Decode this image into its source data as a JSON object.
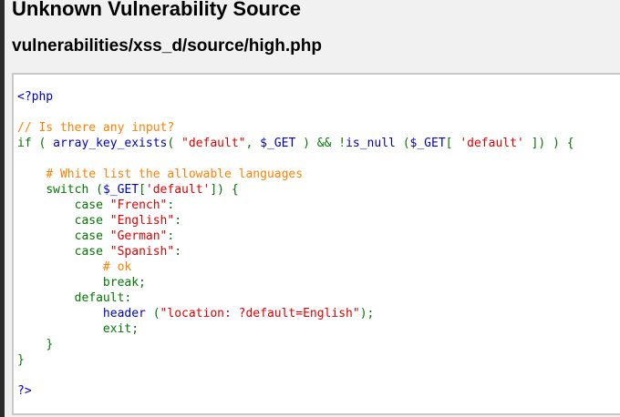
{
  "header": {
    "title": "Unknown Vulnerability Source",
    "file_path": "vulnerabilities/xss_d/source/high.php"
  },
  "colors": {
    "tag": "#0000bb",
    "comment": "#ff8000",
    "keyword": "#007700",
    "string": "#dd0000",
    "variable": "#0000bb"
  },
  "code": {
    "open_tag": "<?php",
    "comment_input": "// Is there any input?",
    "if_prefix": "if ( ",
    "fn_array_key_exists": "array_key_exists",
    "paren_open": "( ",
    "str_default_dq": "\"default\"",
    "comma": ", ",
    "var_get": "$_GET",
    "and_not": " ) && !",
    "fn_is_null": "is_null",
    "paren_space": " (",
    "bracket_open": "[ ",
    "str_default_sq": "'default'",
    "if_close": " ]) ) {",
    "comment_whitelist": "# White list the allowable languages",
    "switch_kw": "switch (",
    "bracket_open_tight": "[",
    "switch_close": "]) {",
    "case_kw": "case ",
    "str_french": "\"French\"",
    "str_english": "\"English\"",
    "str_german": "\"German\"",
    "str_spanish": "\"Spanish\"",
    "colon": ":",
    "comment_ok": "# ok",
    "break_stmt": "break;",
    "default_kw": "default:",
    "fn_header": "header",
    "str_location": "\"location: ?default=English\"",
    "header_close": ");",
    "exit_stmt": "exit;",
    "close_brace": "}",
    "close_tag": "?>"
  }
}
